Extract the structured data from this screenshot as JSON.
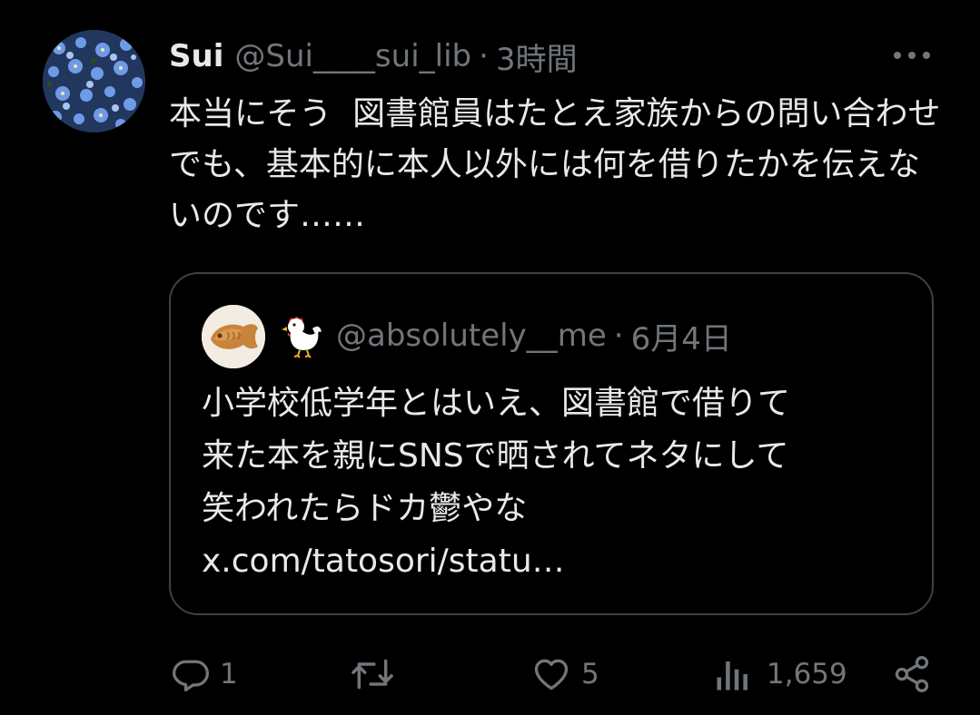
{
  "tweet": {
    "author_name": "Sui",
    "handle": "@Sui____sui_lib",
    "separator": "·",
    "time": "3時間",
    "text": "本当にそう  図書館員はたとえ家族からの問い合わせでも、基本的に本人以外には何を借りたかを伝えないのです……",
    "avatar_icon": "blue-flowers-avatar"
  },
  "quote": {
    "handle": "@absolutely__me",
    "separator": "·",
    "date": "6月4日",
    "emoji": "chicken-emoji",
    "avatar_icon": "taiyaki-avatar",
    "text": "小学校低学年とはいえ、図書館で借りて\n来た本を親にSNSで晒されてネタにして\n笑われたらドカ鬱やな",
    "link": "x.com/tatosori/statu…"
  },
  "actions": {
    "reply_count": "1",
    "repost_count": "",
    "like_count": "5",
    "views_count": "1,659"
  },
  "colors": {
    "background": "#000000",
    "text": "#e7e9ea",
    "secondary": "#71767b",
    "border": "#3e4144"
  }
}
